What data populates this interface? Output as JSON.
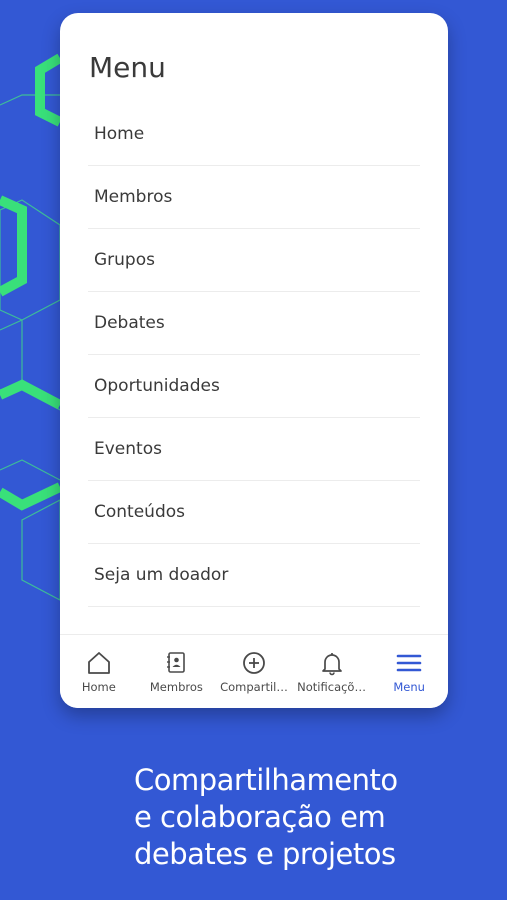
{
  "colors": {
    "background": "#3358d4",
    "hex_accent": "#39e07a",
    "hex_line": "#3fcf8e",
    "active_tab": "#3358d4"
  },
  "menu": {
    "title": "Menu",
    "items": [
      {
        "label": "Home"
      },
      {
        "label": "Membros"
      },
      {
        "label": "Grupos"
      },
      {
        "label": "Debates"
      },
      {
        "label": "Oportunidades"
      },
      {
        "label": "Eventos"
      },
      {
        "label": "Conteúdos"
      },
      {
        "label": "Seja um doador"
      }
    ]
  },
  "tabbar": {
    "tabs": [
      {
        "label": "Home",
        "icon": "home-icon"
      },
      {
        "label": "Membros",
        "icon": "contacts-icon"
      },
      {
        "label": "Compartil…",
        "icon": "plus-circle-icon"
      },
      {
        "label": "Notificaçõ…",
        "icon": "bell-icon"
      },
      {
        "label": "Menu",
        "icon": "menu-icon",
        "active": true
      }
    ]
  },
  "caption": {
    "line1": "Compartilhamento",
    "line2": "e colaboração em",
    "line3": "debates e projetos"
  }
}
